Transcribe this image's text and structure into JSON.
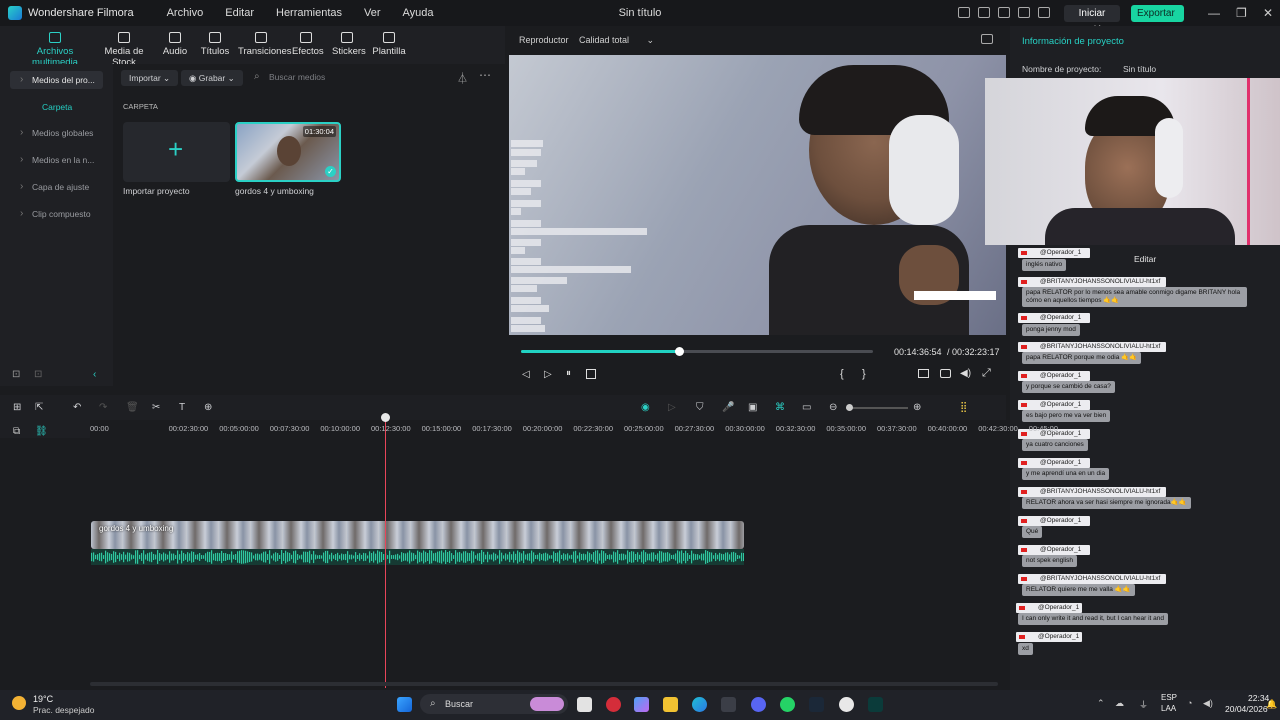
{
  "titlebar": {
    "app_name": "Wondershare Filmora",
    "menu": [
      "Archivo",
      "Editar",
      "Herramientas",
      "Ver",
      "Ayuda"
    ],
    "window_title": "Sin título",
    "login_label": "Iniciar Sesión",
    "export_label": "Exportar"
  },
  "toolbar": {
    "items": [
      "Archivos multimedia",
      "Media de Stock",
      "Audio",
      "Títulos",
      "Transiciones",
      "Efectos",
      "Stickers",
      "Plantilla"
    ]
  },
  "leftnav": {
    "items": [
      "Medios del pro...",
      "Medios globales",
      "Medios en la n...",
      "Capa de ajuste",
      "Clip compuesto"
    ],
    "sub_label": "Carpeta"
  },
  "media": {
    "import_label": "Importar",
    "record_label": "Grabar",
    "search_placeholder": "Buscar medios",
    "folder_label": "CARPETA",
    "import_project_label": "Importar proyecto",
    "clip_name": "gordos 4 y umboxing",
    "clip_duration": "01:30:04"
  },
  "preview": {
    "player_label": "Reproductor",
    "quality_label": "Calidad total",
    "current_time": "00:14:36:54",
    "total_time": "/ 00:32:23:17",
    "progress": 0.45
  },
  "info_panel": {
    "title": "Información de proyecto",
    "name_label": "Nombre de proyecto:",
    "name_value": "Sin título",
    "edit_label": "Editar"
  },
  "chat": [
    {
      "user": "@Operador_1",
      "msg": "inglés nativo"
    },
    {
      "user": "@BRITANYJOHANSSONOLIVIALU-ht1xf",
      "msg": "papa RELATOR por lo menos sea amable conmigo digame BRITANY hola cómo en aquellos tiempos 🤙🤙"
    },
    {
      "user": "@Operador_1",
      "msg": "ponga jenny mod"
    },
    {
      "user": "@BRITANYJOHANSSONOLIVIALU-ht1xf",
      "msg": "papa RELATOR porque me odia 🤙🤙"
    },
    {
      "user": "@Operador_1",
      "msg": "y porque se cambió de casa?"
    },
    {
      "user": "@Operador_1",
      "msg": "es bajo pero me va ver bien"
    },
    {
      "user": "@Operador_1",
      "msg": "ya cuatro canciones"
    },
    {
      "user": "@Operador_1",
      "msg": "y me aprendí una en un dia"
    },
    {
      "user": "@BRITANYJOHANSSONOLIVIALU-ht1xf",
      "msg": "RELATOR ahora va ser hasi siempre me ignorada🤙🤙"
    },
    {
      "user": "@Operador_1",
      "msg": "Qué"
    },
    {
      "user": "@Operador_1",
      "msg": "not spek english"
    },
    {
      "user": "@BRITANYJOHANSSONOLIVIALU-ht1xf",
      "msg": "RELATOR quiere me me valla 🤙🤙"
    },
    {
      "user": "@Operador_1",
      "msg": "I can only write it and read it, but I can hear it and"
    },
    {
      "user": "@Operador_1",
      "msg": "xd"
    }
  ],
  "timeline": {
    "ruler": [
      "00:00",
      "00:02:30:00",
      "00:05:00:00",
      "00:07:30:00",
      "00:10:00:00",
      "00:12:30:00",
      "00:15:00:00",
      "00:17:30:00",
      "00:20:00:00",
      "00:22:30:00",
      "00:25:00:00",
      "00:27:30:00",
      "00:30:00:00",
      "00:32:30:00",
      "00:35:00:00",
      "00:37:30:00",
      "00:40:00:00",
      "00:42:30:00",
      "00:45:00"
    ],
    "clip_label": "gordos 4 y umboxing",
    "video_track": "1",
    "audio_track": "1"
  },
  "taskbar": {
    "weather_temp": "19°C",
    "weather_desc": "Prac. despejado",
    "search_label": "Buscar",
    "lang_top": "ESP",
    "lang_bottom": "LAA",
    "time": "22:34",
    "date": "20/04/2026"
  }
}
